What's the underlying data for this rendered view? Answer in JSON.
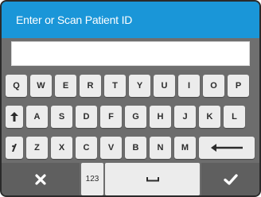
{
  "title": "Enter or Scan Patient ID",
  "patient_id": {
    "value": "",
    "placeholder": ""
  },
  "keyboard": {
    "row1": [
      "Q",
      "W",
      "E",
      "R",
      "T",
      "Y",
      "U",
      "I",
      "O",
      "P"
    ],
    "row2": [
      "A",
      "S",
      "D",
      "F",
      "G",
      "H",
      "J",
      "K",
      "L"
    ],
    "row3": [
      "Z",
      "X",
      "C",
      "V",
      "B",
      "N",
      "M"
    ],
    "numbers_label": "123",
    "icons": {
      "shift": "shift-arrow-up-icon",
      "special": "symbol-key-icon",
      "backspace": "backspace-arrow-icon",
      "cancel": "close-x-icon",
      "space": "spacebar-icon",
      "confirm": "checkmark-icon"
    }
  },
  "colors": {
    "title_bar": "#1a96d8",
    "keyboard_bg": "#6d6d6d",
    "key_bg": "#ececec",
    "key_text": "#2c2c2c"
  }
}
